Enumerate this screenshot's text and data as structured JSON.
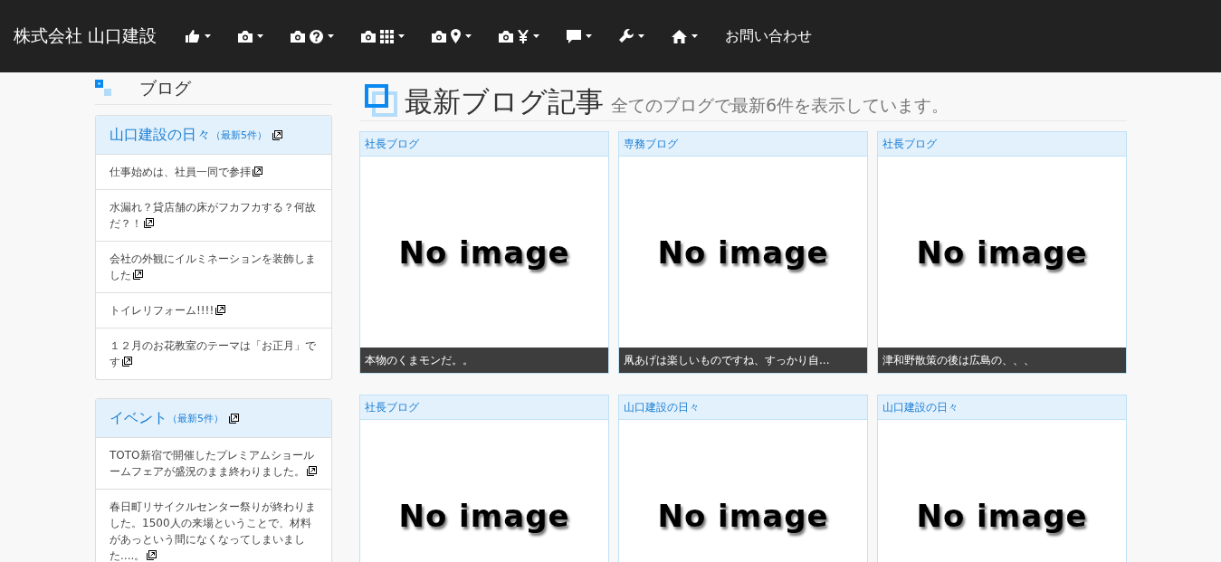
{
  "navbar": {
    "brand": "株式会社 山口建設",
    "items": [
      {
        "kind": "icon-menu"
      },
      {
        "kind": "icon-menu"
      },
      {
        "kind": "icon-menu"
      },
      {
        "kind": "icon-menu"
      },
      {
        "kind": "icon-menu"
      },
      {
        "kind": "icon-menu"
      },
      {
        "kind": "icon-menu"
      },
      {
        "kind": "icon-menu"
      },
      {
        "kind": "icon-menu"
      },
      {
        "kind": "link",
        "label": "お問い合わせ"
      }
    ]
  },
  "sidebar": {
    "heading": "ブログ",
    "panels": [
      {
        "title": "山口建設の日々",
        "count": "（最新5件）",
        "items": [
          "仕事始めは、社員一同で参拝",
          "水漏れ？貸店舗の床がフカフカする？何故だ？！",
          "会社の外観にイルミネーションを装飾しました",
          "トイレリフォーム!!!!",
          "１２月のお花教室のテーマは「お正月」です"
        ]
      },
      {
        "title": "イベント",
        "count": "（最新5件）",
        "items": [
          "TOTO新宿で開催したプレミアムショールームフェアが盛況のまま終わりました。",
          "春日町リサイクルセンター祭りが終わりました。1500人の来場ということで、材料があっという間になくなってしまいました....。"
        ]
      }
    ]
  },
  "main": {
    "title": "最新ブログ記事",
    "subtitle": "全てのブログで最新6件を表示しています。",
    "posts": [
      {
        "category": "社長ブログ",
        "image_text": "No image",
        "caption": "本物のくまモンだ。。"
      },
      {
        "category": "専務ブログ",
        "image_text": "No image",
        "caption": "凧あげは楽しいものですね、すっかり自..."
      },
      {
        "category": "社長ブログ",
        "image_text": "No image",
        "caption": "津和野散策の後は広島の、、、"
      },
      {
        "category": "社長ブログ",
        "image_text": "No image"
      },
      {
        "category": "山口建設の日々",
        "image_text": "No image"
      },
      {
        "category": "山口建設の日々",
        "image_text": "No image"
      }
    ]
  }
}
